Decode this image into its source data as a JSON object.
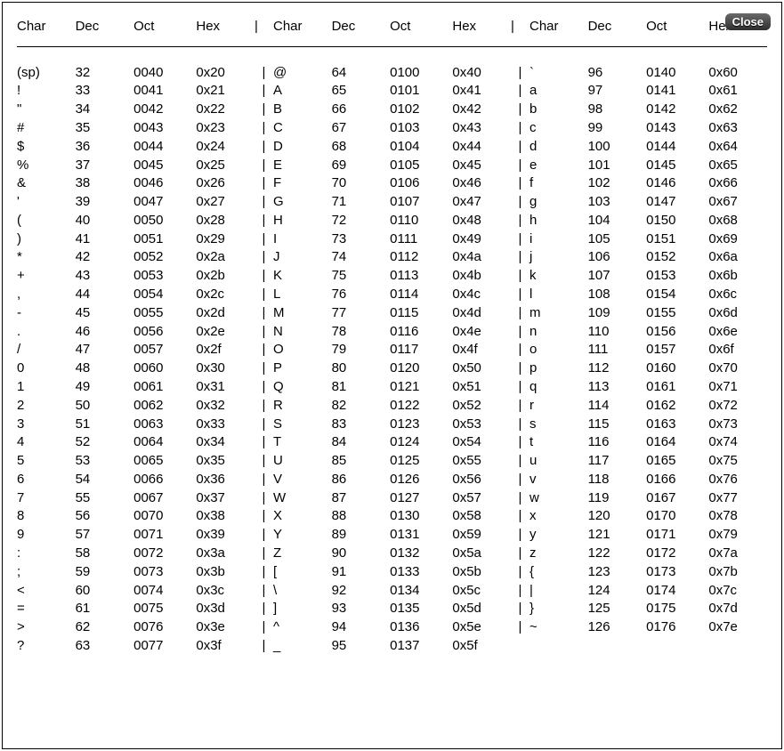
{
  "close_label": "Close",
  "columns": [
    "Char",
    "Dec",
    "Oct",
    "Hex"
  ],
  "separator": "|",
  "block_count": 3,
  "rows_per_block": 32,
  "blocks": [
    [
      {
        "char": "(sp)",
        "dec": "32",
        "oct": "0040",
        "hex": "0x20"
      },
      {
        "char": "!",
        "dec": "33",
        "oct": "0041",
        "hex": "0x21"
      },
      {
        "char": "\"",
        "dec": "34",
        "oct": "0042",
        "hex": "0x22"
      },
      {
        "char": "#",
        "dec": "35",
        "oct": "0043",
        "hex": "0x23"
      },
      {
        "char": "$",
        "dec": "36",
        "oct": "0044",
        "hex": "0x24"
      },
      {
        "char": "%",
        "dec": "37",
        "oct": "0045",
        "hex": "0x25"
      },
      {
        "char": "&",
        "dec": "38",
        "oct": "0046",
        "hex": "0x26"
      },
      {
        "char": "'",
        "dec": "39",
        "oct": "0047",
        "hex": "0x27"
      },
      {
        "char": "(",
        "dec": "40",
        "oct": "0050",
        "hex": "0x28"
      },
      {
        "char": ")",
        "dec": "41",
        "oct": "0051",
        "hex": "0x29"
      },
      {
        "char": "*",
        "dec": "42",
        "oct": "0052",
        "hex": "0x2a"
      },
      {
        "char": "+",
        "dec": "43",
        "oct": "0053",
        "hex": "0x2b"
      },
      {
        "char": ",",
        "dec": "44",
        "oct": "0054",
        "hex": "0x2c"
      },
      {
        "char": "-",
        "dec": "45",
        "oct": "0055",
        "hex": "0x2d"
      },
      {
        "char": ".",
        "dec": "46",
        "oct": "0056",
        "hex": "0x2e"
      },
      {
        "char": "/",
        "dec": "47",
        "oct": "0057",
        "hex": "0x2f"
      },
      {
        "char": "0",
        "dec": "48",
        "oct": "0060",
        "hex": "0x30"
      },
      {
        "char": "1",
        "dec": "49",
        "oct": "0061",
        "hex": "0x31"
      },
      {
        "char": "2",
        "dec": "50",
        "oct": "0062",
        "hex": "0x32"
      },
      {
        "char": "3",
        "dec": "51",
        "oct": "0063",
        "hex": "0x33"
      },
      {
        "char": "4",
        "dec": "52",
        "oct": "0064",
        "hex": "0x34"
      },
      {
        "char": "5",
        "dec": "53",
        "oct": "0065",
        "hex": "0x35"
      },
      {
        "char": "6",
        "dec": "54",
        "oct": "0066",
        "hex": "0x36"
      },
      {
        "char": "7",
        "dec": "55",
        "oct": "0067",
        "hex": "0x37"
      },
      {
        "char": "8",
        "dec": "56",
        "oct": "0070",
        "hex": "0x38"
      },
      {
        "char": "9",
        "dec": "57",
        "oct": "0071",
        "hex": "0x39"
      },
      {
        "char": ":",
        "dec": "58",
        "oct": "0072",
        "hex": "0x3a"
      },
      {
        "char": ";",
        "dec": "59",
        "oct": "0073",
        "hex": "0x3b"
      },
      {
        "char": "<",
        "dec": "60",
        "oct": "0074",
        "hex": "0x3c"
      },
      {
        "char": "=",
        "dec": "61",
        "oct": "0075",
        "hex": "0x3d"
      },
      {
        "char": ">",
        "dec": "62",
        "oct": "0076",
        "hex": "0x3e"
      },
      {
        "char": "?",
        "dec": "63",
        "oct": "0077",
        "hex": "0x3f"
      }
    ],
    [
      {
        "char": "@",
        "dec": "64",
        "oct": "0100",
        "hex": "0x40"
      },
      {
        "char": "A",
        "dec": "65",
        "oct": "0101",
        "hex": "0x41"
      },
      {
        "char": "B",
        "dec": "66",
        "oct": "0102",
        "hex": "0x42"
      },
      {
        "char": "C",
        "dec": "67",
        "oct": "0103",
        "hex": "0x43"
      },
      {
        "char": "D",
        "dec": "68",
        "oct": "0104",
        "hex": "0x44"
      },
      {
        "char": "E",
        "dec": "69",
        "oct": "0105",
        "hex": "0x45"
      },
      {
        "char": "F",
        "dec": "70",
        "oct": "0106",
        "hex": "0x46"
      },
      {
        "char": "G",
        "dec": "71",
        "oct": "0107",
        "hex": "0x47"
      },
      {
        "char": "H",
        "dec": "72",
        "oct": "0110",
        "hex": "0x48"
      },
      {
        "char": "I",
        "dec": "73",
        "oct": "0111",
        "hex": "0x49"
      },
      {
        "char": "J",
        "dec": "74",
        "oct": "0112",
        "hex": "0x4a"
      },
      {
        "char": "K",
        "dec": "75",
        "oct": "0113",
        "hex": "0x4b"
      },
      {
        "char": "L",
        "dec": "76",
        "oct": "0114",
        "hex": "0x4c"
      },
      {
        "char": "M",
        "dec": "77",
        "oct": "0115",
        "hex": "0x4d"
      },
      {
        "char": "N",
        "dec": "78",
        "oct": "0116",
        "hex": "0x4e"
      },
      {
        "char": "O",
        "dec": "79",
        "oct": "0117",
        "hex": "0x4f"
      },
      {
        "char": "P",
        "dec": "80",
        "oct": "0120",
        "hex": "0x50"
      },
      {
        "char": "Q",
        "dec": "81",
        "oct": "0121",
        "hex": "0x51"
      },
      {
        "char": "R",
        "dec": "82",
        "oct": "0122",
        "hex": "0x52"
      },
      {
        "char": "S",
        "dec": "83",
        "oct": "0123",
        "hex": "0x53"
      },
      {
        "char": "T",
        "dec": "84",
        "oct": "0124",
        "hex": "0x54"
      },
      {
        "char": "U",
        "dec": "85",
        "oct": "0125",
        "hex": "0x55"
      },
      {
        "char": "V",
        "dec": "86",
        "oct": "0126",
        "hex": "0x56"
      },
      {
        "char": "W",
        "dec": "87",
        "oct": "0127",
        "hex": "0x57"
      },
      {
        "char": "X",
        "dec": "88",
        "oct": "0130",
        "hex": "0x58"
      },
      {
        "char": "Y",
        "dec": "89",
        "oct": "0131",
        "hex": "0x59"
      },
      {
        "char": "Z",
        "dec": "90",
        "oct": "0132",
        "hex": "0x5a"
      },
      {
        "char": "[",
        "dec": "91",
        "oct": "0133",
        "hex": "0x5b"
      },
      {
        "char": "\\",
        "dec": "92",
        "oct": "0134",
        "hex": "0x5c"
      },
      {
        "char": "]",
        "dec": "93",
        "oct": "0135",
        "hex": "0x5d"
      },
      {
        "char": "^",
        "dec": "94",
        "oct": "0136",
        "hex": "0x5e"
      },
      {
        "char": "_",
        "dec": "95",
        "oct": "0137",
        "hex": "0x5f"
      }
    ],
    [
      {
        "char": "`",
        "dec": "96",
        "oct": "0140",
        "hex": "0x60"
      },
      {
        "char": "a",
        "dec": "97",
        "oct": "0141",
        "hex": "0x61"
      },
      {
        "char": "b",
        "dec": "98",
        "oct": "0142",
        "hex": "0x62"
      },
      {
        "char": "c",
        "dec": "99",
        "oct": "0143",
        "hex": "0x63"
      },
      {
        "char": "d",
        "dec": "100",
        "oct": "0144",
        "hex": "0x64"
      },
      {
        "char": "e",
        "dec": "101",
        "oct": "0145",
        "hex": "0x65"
      },
      {
        "char": "f",
        "dec": "102",
        "oct": "0146",
        "hex": "0x66"
      },
      {
        "char": "g",
        "dec": "103",
        "oct": "0147",
        "hex": "0x67"
      },
      {
        "char": "h",
        "dec": "104",
        "oct": "0150",
        "hex": "0x68"
      },
      {
        "char": "i",
        "dec": "105",
        "oct": "0151",
        "hex": "0x69"
      },
      {
        "char": "j",
        "dec": "106",
        "oct": "0152",
        "hex": "0x6a"
      },
      {
        "char": "k",
        "dec": "107",
        "oct": "0153",
        "hex": "0x6b"
      },
      {
        "char": "l",
        "dec": "108",
        "oct": "0154",
        "hex": "0x6c"
      },
      {
        "char": "m",
        "dec": "109",
        "oct": "0155",
        "hex": "0x6d"
      },
      {
        "char": "n",
        "dec": "110",
        "oct": "0156",
        "hex": "0x6e"
      },
      {
        "char": "o",
        "dec": "111",
        "oct": "0157",
        "hex": "0x6f"
      },
      {
        "char": "p",
        "dec": "112",
        "oct": "0160",
        "hex": "0x70"
      },
      {
        "char": "q",
        "dec": "113",
        "oct": "0161",
        "hex": "0x71"
      },
      {
        "char": "r",
        "dec": "114",
        "oct": "0162",
        "hex": "0x72"
      },
      {
        "char": "s",
        "dec": "115",
        "oct": "0163",
        "hex": "0x73"
      },
      {
        "char": "t",
        "dec": "116",
        "oct": "0164",
        "hex": "0x74"
      },
      {
        "char": "u",
        "dec": "117",
        "oct": "0165",
        "hex": "0x75"
      },
      {
        "char": "v",
        "dec": "118",
        "oct": "0166",
        "hex": "0x76"
      },
      {
        "char": "w",
        "dec": "119",
        "oct": "0167",
        "hex": "0x77"
      },
      {
        "char": "x",
        "dec": "120",
        "oct": "0170",
        "hex": "0x78"
      },
      {
        "char": "y",
        "dec": "121",
        "oct": "0171",
        "hex": "0x79"
      },
      {
        "char": "z",
        "dec": "122",
        "oct": "0172",
        "hex": "0x7a"
      },
      {
        "char": "{",
        "dec": "123",
        "oct": "0173",
        "hex": "0x7b"
      },
      {
        "char": "|",
        "dec": "124",
        "oct": "0174",
        "hex": "0x7c"
      },
      {
        "char": "}",
        "dec": "125",
        "oct": "0175",
        "hex": "0x7d"
      },
      {
        "char": "~",
        "dec": "126",
        "oct": "0176",
        "hex": "0x7e"
      },
      {
        "char": "",
        "dec": "",
        "oct": "",
        "hex": ""
      }
    ]
  ]
}
